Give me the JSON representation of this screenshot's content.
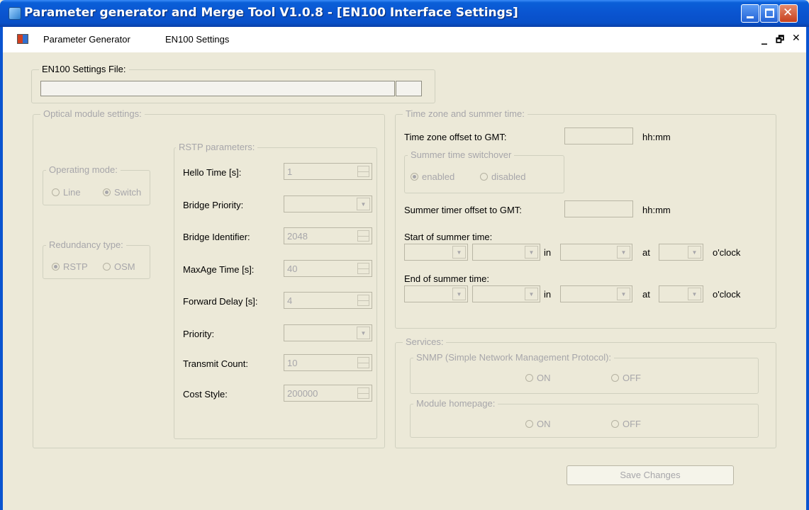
{
  "window": {
    "title": "Parameter generator and Merge Tool V1.0.8 - [EN100 Interface Settings]"
  },
  "menu": {
    "items": [
      "Parameter Generator",
      "EN100 Settings"
    ],
    "mdi_min": "_",
    "mdi_restore": "🗗",
    "mdi_close": "✕"
  },
  "settings_file": {
    "legend": "EN100 Settings File:",
    "value": ""
  },
  "optical": {
    "legend": "Optical module settings:",
    "operating_mode": {
      "legend": "Operating mode:",
      "options": [
        "Line",
        "Switch"
      ],
      "selected": "Switch"
    },
    "redundancy": {
      "legend": "Redundancy type:",
      "options": [
        "RSTP",
        "OSM"
      ],
      "selected": "RSTP"
    },
    "rstp": {
      "legend": "RSTP parameters:",
      "hello_label": "Hello Time [s]:",
      "hello_value": "1",
      "bridge_priority_label": "Bridge Priority:",
      "bridge_priority_value": "",
      "bridge_id_label": "Bridge Identifier:",
      "bridge_id_value": "2048",
      "maxage_label": "MaxAge Time [s]:",
      "maxage_value": "40",
      "fwd_delay_label": "Forward Delay [s]:",
      "fwd_delay_value": "4",
      "priority_label": "Priority:",
      "priority_value": "",
      "tx_count_label": "Transmit Count:",
      "tx_count_value": "10",
      "cost_style_label": "Cost Style:",
      "cost_style_value": "200000"
    }
  },
  "timezone": {
    "legend": "Time zone and summer time:",
    "offset_label": "Time zone offset to GMT:",
    "offset_value": "",
    "offset_unit": "hh:mm",
    "switchover": {
      "legend": "Summer time switchover",
      "options": [
        "enabled",
        "disabled"
      ],
      "selected": "enabled"
    },
    "summer_offset_label": "Summer timer offset to GMT:",
    "summer_offset_value": "",
    "summer_offset_unit": "hh:mm",
    "start_label": "Start of summer time:",
    "end_label": "End of summer time:",
    "in_label": "in",
    "at_label": "at",
    "oclock_label": "o'clock"
  },
  "services": {
    "legend": "Services:",
    "snmp": {
      "legend": "SNMP (Simple Network Management Protocol):",
      "on": "ON",
      "off": "OFF"
    },
    "homepage": {
      "legend": "Module homepage:",
      "on": "ON",
      "off": "OFF"
    }
  },
  "save_button": "Save Changes"
}
